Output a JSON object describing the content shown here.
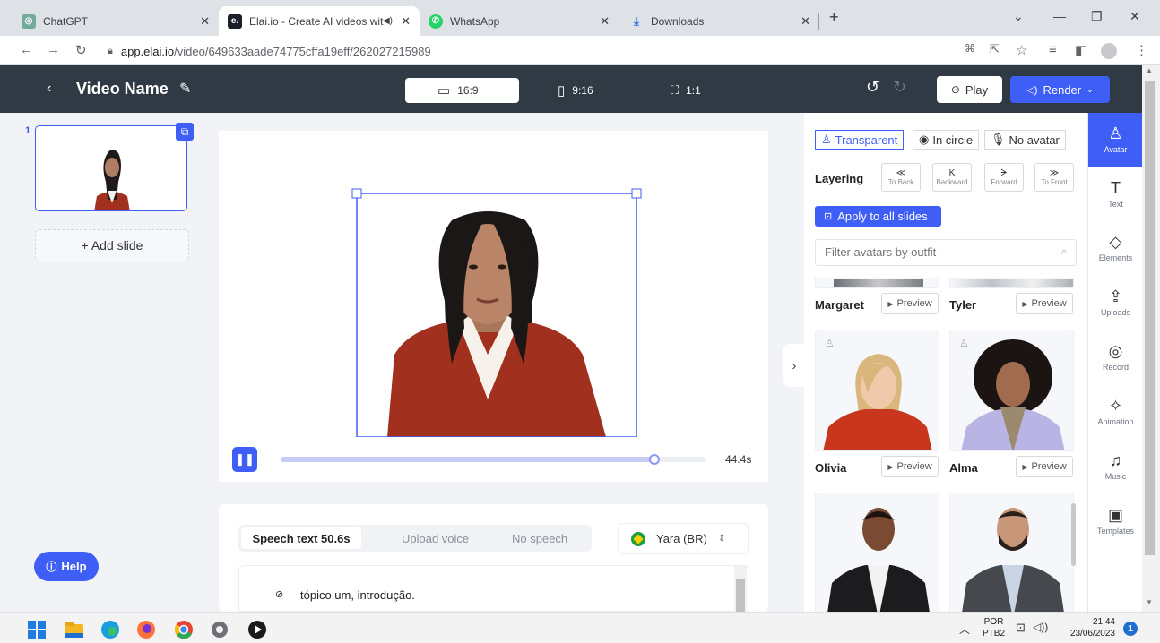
{
  "browser": {
    "tabs": [
      {
        "title": "ChatGPT",
        "icon": "chatgpt-icon"
      },
      {
        "title": "Elai.io - Create AI videos wit",
        "icon": "elai-icon"
      },
      {
        "title": "WhatsApp",
        "icon": "whatsapp-icon"
      },
      {
        "title": "Downloads",
        "icon": "download-icon"
      }
    ],
    "new_tab": "+",
    "url_host": "app.elai.io",
    "url_path": "/video/649633aade74775cffa19eff/262027215989"
  },
  "header": {
    "title": "Video Name",
    "ratios": [
      {
        "label": "16:9",
        "active": true
      },
      {
        "label": "9:16",
        "active": false
      },
      {
        "label": "1:1",
        "active": false
      }
    ],
    "play_label": "Play",
    "render_label": "Render"
  },
  "slides": {
    "items": [
      {
        "number": "1"
      }
    ],
    "add_label": "+ Add slide"
  },
  "player": {
    "duration": "44.4s",
    "progress": 0.88
  },
  "speech": {
    "tabs": [
      "Speech text 50.6s",
      "Upload voice",
      "No speech"
    ],
    "voice": "Yara (BR)",
    "text": "tópico um, introdução."
  },
  "help_label": "Help",
  "avatar_panel": {
    "modes": [
      "Transparent",
      "In circle",
      "No avatar"
    ],
    "layering_label": "Layering",
    "layering_buttons": [
      {
        "glyph": "≪",
        "label": "To Back"
      },
      {
        "glyph": "K",
        "label": "Backward"
      },
      {
        "glyph": "ᗒ",
        "label": "Forward"
      },
      {
        "glyph": "≫",
        "label": "To Front"
      }
    ],
    "apply_label": "Apply to all slides",
    "filter_placeholder": "Filter avatars by outfit",
    "avatars": [
      {
        "name": "Margaret",
        "preview": "Preview"
      },
      {
        "name": "Tyler",
        "preview": "Preview"
      },
      {
        "name": "Olivia",
        "preview": "Preview"
      },
      {
        "name": "Alma",
        "preview": "Preview"
      }
    ]
  },
  "toolbar": [
    {
      "label": "Avatar",
      "icon": "avatar-icon",
      "active": true
    },
    {
      "label": "Text",
      "icon": "text-icon"
    },
    {
      "label": "Elements",
      "icon": "elements-icon"
    },
    {
      "label": "Uploads",
      "icon": "upload-icon"
    },
    {
      "label": "Record",
      "icon": "record-icon"
    },
    {
      "label": "Animation",
      "icon": "animation-icon"
    },
    {
      "label": "Music",
      "icon": "music-icon"
    },
    {
      "label": "Templates",
      "icon": "templates-icon"
    }
  ],
  "taskbar": {
    "lang_line1": "POR",
    "lang_line2": "PTB2",
    "time": "21:44",
    "date": "23/06/2023",
    "notifications": "1"
  },
  "colors": {
    "accent": "#3f5ef5",
    "header_bg": "#2f3a44",
    "sweater": "#a2301f",
    "lavender": "#b9b4e4"
  }
}
